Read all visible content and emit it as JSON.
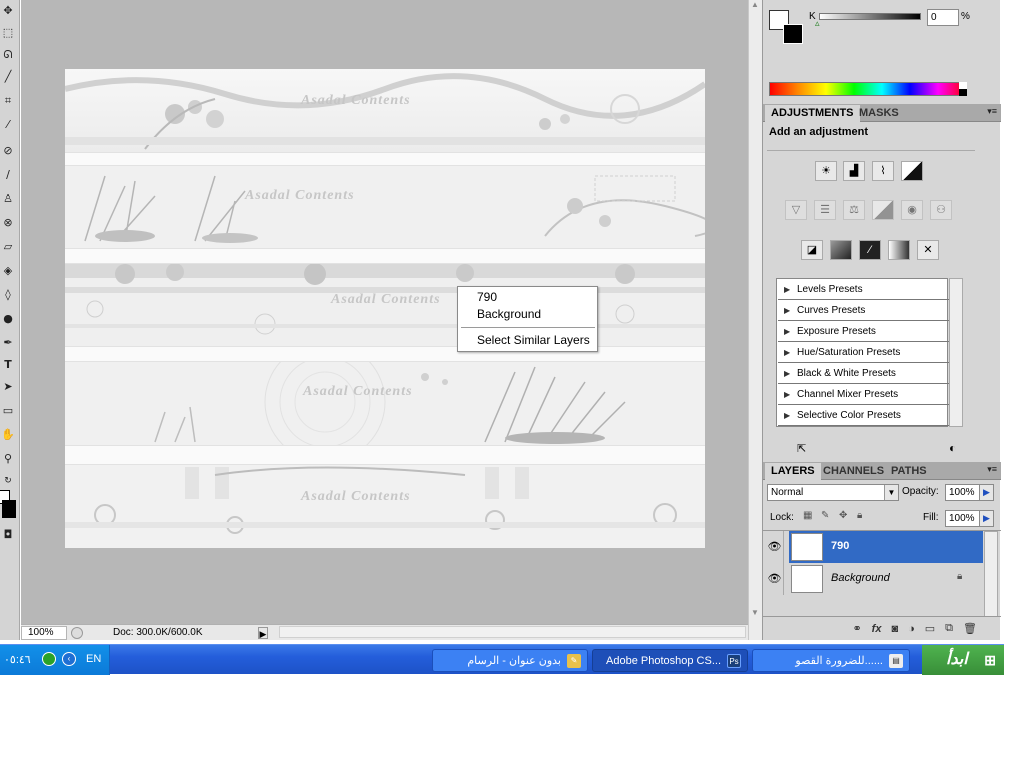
{
  "colors": {
    "workspace": "#b7b7b7",
    "panel": "#d6d6d6",
    "taskbar": "#245edb",
    "selection": "#316ac5",
    "start": "#3c9a3c"
  },
  "canvas": {
    "watermark": "Asadal Contents"
  },
  "context_menu": {
    "items": [
      {
        "label": "790"
      },
      {
        "label": "Background"
      },
      {
        "label": "Select Similar Layers"
      }
    ]
  },
  "statusbar": {
    "zoom": "100%",
    "doc": "Doc: 300.0K/600.0K"
  },
  "color_panel": {
    "slider_label": "K",
    "value": "0",
    "unit": "%"
  },
  "adjustments": {
    "tabs": [
      "ADJUSTMENTS",
      "MASKS"
    ],
    "title": "Add an adjustment",
    "presets": [
      "Levels Presets",
      "Curves Presets",
      "Exposure Presets",
      "Hue/Saturation Presets",
      "Black & White Presets",
      "Channel Mixer Presets",
      "Selective Color Presets"
    ]
  },
  "layers": {
    "tabs": [
      "LAYERS",
      "CHANNELS",
      "PATHS"
    ],
    "blend_mode": "Normal",
    "opacity_label": "Opacity:",
    "opacity": "100%",
    "lock_label": "Lock:",
    "fill_label": "Fill:",
    "fill": "100%",
    "items": [
      {
        "name": "790",
        "selected": true
      },
      {
        "name": "Background",
        "selected": false
      }
    ]
  },
  "taskbar": {
    "start": "ابدأ",
    "tasks": [
      "للضرورة القصو......",
      "Adobe Photoshop CS...",
      "بدون عنوان - الرسام"
    ],
    "language": "EN",
    "clock": "٠٥:٤٦"
  }
}
